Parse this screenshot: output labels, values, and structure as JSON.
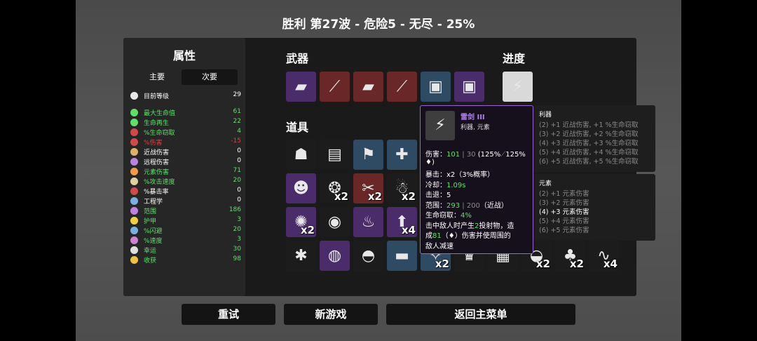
{
  "header": {
    "title": "胜利    第27波 - 危险5 - 无尽 - 25%"
  },
  "stats": {
    "title": "属性",
    "tabs": {
      "main": "主要",
      "secondary": "次要"
    },
    "level": {
      "label": "目前等级",
      "value": "29"
    },
    "rows": [
      {
        "label": "最大生命值",
        "value": "61",
        "color": "#5fe06a",
        "icon_color": "#5fe06a",
        "icon": "heart-icon"
      },
      {
        "label": "生命再生",
        "value": "22",
        "color": "#5fe06a",
        "icon_color": "#5fe06a",
        "icon": "regen-icon"
      },
      {
        "label": "%生命窃取",
        "value": "4",
        "color": "#5fe06a",
        "icon_color": "#d04a4a",
        "icon": "lifesteal-icon"
      },
      {
        "label": "%伤害",
        "value": "-15",
        "color": "#e04040",
        "icon_color": "#d04a4a",
        "icon": "damage-icon"
      },
      {
        "label": "近战伤害",
        "value": "0",
        "color": "#ffffff",
        "icon_color": "#d9b36a",
        "icon": "melee-icon"
      },
      {
        "label": "远程伤害",
        "value": "0",
        "color": "#ffffff",
        "icon_color": "#b486e0",
        "icon": "ranged-icon"
      },
      {
        "label": "元素伤害",
        "value": "71",
        "color": "#5fe06a",
        "icon_color": "#f09a4a",
        "icon": "elemental-icon"
      },
      {
        "label": "%攻击速度",
        "value": "20",
        "color": "#5fe06a",
        "icon_color": "#e0d0a0",
        "icon": "attack-speed-icon"
      },
      {
        "label": "%暴击率",
        "value": "0",
        "color": "#ffffff",
        "icon_color": "#d04a4a",
        "icon": "crit-icon"
      },
      {
        "label": "工程学",
        "value": "0",
        "color": "#ffffff",
        "icon_color": "#7ab0e0",
        "icon": "engineering-icon"
      },
      {
        "label": "范围",
        "value": "186",
        "color": "#5fe06a",
        "icon_color": "#c080e0",
        "icon": "range-icon"
      },
      {
        "label": "护甲",
        "value": "3",
        "color": "#5fe06a",
        "icon_color": "#f0d040",
        "icon": "armor-icon"
      },
      {
        "label": "%闪避",
        "value": "20",
        "color": "#5fe06a",
        "icon_color": "#7ab0e0",
        "icon": "dodge-icon"
      },
      {
        "label": "%速度",
        "value": "3",
        "color": "#5fe06a",
        "icon_color": "#d080d0",
        "icon": "speed-icon"
      },
      {
        "label": "幸运",
        "value": "30",
        "color": "#5fe06a",
        "icon_color": "#e0e0e0",
        "icon": "luck-icon"
      },
      {
        "label": "收获",
        "value": "98",
        "color": "#5fe06a",
        "icon_color": "#f0c040",
        "icon": "harvest-icon"
      }
    ]
  },
  "weapons": {
    "title": "武器",
    "items": [
      {
        "name": "rocket-launcher-icon",
        "tier": "t3",
        "glyph": "▰",
        "count": ""
      },
      {
        "name": "magic-wand-icon",
        "tier": "t4",
        "glyph": "⟋",
        "count": ""
      },
      {
        "name": "rocket-launcher-icon",
        "tier": "t4",
        "glyph": "▰",
        "count": ""
      },
      {
        "name": "magic-wand-icon",
        "tier": "t4",
        "glyph": "⟋",
        "count": ""
      },
      {
        "name": "flamethrower-icon",
        "tier": "t2",
        "glyph": "▣",
        "count": ""
      },
      {
        "name": "flamethrower-icon",
        "tier": "t3",
        "glyph": "▣",
        "count": ""
      }
    ]
  },
  "progress": {
    "title": "进度",
    "items": [
      {
        "name": "thunder-sword-icon",
        "tier": "t5",
        "glyph": "⚡",
        "count": ""
      }
    ]
  },
  "items": {
    "title": "道具",
    "rows": [
      [
        {
          "name": "mushroom-icon",
          "tier": "t1",
          "glyph": "☗",
          "count": ""
        },
        {
          "name": "banknote-icon",
          "tier": "t1",
          "glyph": "▤",
          "count": ""
        },
        {
          "name": "flag-icon",
          "tier": "t2",
          "glyph": "⚑",
          "count": ""
        },
        {
          "name": "medkit-robot-icon",
          "tier": "t2",
          "glyph": "✚",
          "count": ""
        }
      ],
      [
        {
          "name": "zombie-head-icon",
          "tier": "t3",
          "glyph": "☻",
          "count": ""
        },
        {
          "name": "tardigrade-icon",
          "tier": "t1",
          "glyph": "❂",
          "count": "x2"
        },
        {
          "name": "scissors-icon",
          "tier": "t4",
          "glyph": "✂",
          "count": "x2"
        },
        {
          "name": "ghost-icon",
          "tier": "t1",
          "glyph": "☃",
          "count": "x2"
        }
      ],
      [
        {
          "name": "peacock-icon",
          "tier": "t3",
          "glyph": "✺",
          "count": "x2"
        },
        {
          "name": "helmet-robot-icon",
          "tier": "t1",
          "glyph": "◉",
          "count": ""
        },
        {
          "name": "candle-icon",
          "tier": "t3",
          "glyph": "♨",
          "count": ""
        },
        {
          "name": "rocket-icon",
          "tier": "t3",
          "glyph": "⬆",
          "count": "x4"
        }
      ],
      [
        {
          "name": "spider-icon",
          "tier": "t1",
          "glyph": "✱",
          "count": ""
        },
        {
          "name": "snake-ring-icon",
          "tier": "t3",
          "glyph": "◍",
          "count": ""
        },
        {
          "name": "landmine-icon",
          "tier": "t1",
          "glyph": "◓",
          "count": ""
        },
        {
          "name": "scarf-icon",
          "tier": "t2",
          "glyph": "▬",
          "count": ""
        },
        {
          "name": "drone-icon",
          "tier": "t2",
          "glyph": "✧",
          "count": "x2"
        },
        {
          "name": "crown-icon",
          "tier": "t1",
          "glyph": "♛",
          "count": ""
        },
        {
          "name": "jacket-icon",
          "tier": "t1",
          "glyph": "▦",
          "count": ""
        },
        {
          "name": "bowl-icon",
          "tier": "t1",
          "glyph": "◒",
          "count": "x2"
        },
        {
          "name": "tree-icon",
          "tier": "t1",
          "glyph": "♣",
          "count": "x2"
        },
        {
          "name": "worm-icon",
          "tier": "t1",
          "glyph": "∿",
          "count": "x4"
        }
      ]
    ]
  },
  "tooltip": {
    "name": "雷剑 III",
    "tags": "利器, 元素",
    "lines": [
      {
        "parts": [
          {
            "t": "伤害：",
            "c": ""
          },
          {
            "t": "101",
            "c": "green"
          },
          {
            "t": " | 30",
            "c": "gray"
          },
          {
            "t": " (125%",
            "c": ""
          },
          {
            "t": "⟋",
            "c": "gray"
          },
          {
            "t": "125%",
            "c": ""
          }
        ]
      },
      {
        "parts": [
          {
            "t": "♦)",
            "c": ""
          }
        ]
      },
      {
        "parts": [
          {
            "t": "暴击：x2（3%概率）",
            "c": ""
          }
        ]
      },
      {
        "parts": [
          {
            "t": "冷却：",
            "c": ""
          },
          {
            "t": "1.09s",
            "c": "green"
          }
        ]
      },
      {
        "parts": [
          {
            "t": "击退：5",
            "c": ""
          }
        ]
      },
      {
        "parts": [
          {
            "t": "范围：",
            "c": ""
          },
          {
            "t": "293",
            "c": "green"
          },
          {
            "t": " | 200",
            "c": "gray"
          },
          {
            "t": "（近战）",
            "c": ""
          }
        ]
      },
      {
        "parts": [
          {
            "t": "生命窃取：",
            "c": ""
          },
          {
            "t": "4%",
            "c": "green"
          }
        ]
      },
      {
        "parts": [
          {
            "t": "击中敌人时产生",
            "c": ""
          },
          {
            "t": "2",
            "c": "green"
          },
          {
            "t": "投射物，造",
            "c": ""
          }
        ]
      },
      {
        "parts": [
          {
            "t": "成",
            "c": ""
          },
          {
            "t": "81",
            "c": "green"
          },
          {
            "t": "（♦）伤害并使周围的",
            "c": ""
          }
        ]
      },
      {
        "parts": [
          {
            "t": "敌人减速",
            "c": ""
          }
        ]
      }
    ]
  },
  "set_bonus_sharp": {
    "title": "利器",
    "lines": [
      {
        "text": "(2) +1 近战伤害, +1 %生命窃取",
        "on": false
      },
      {
        "text": "(3) +2 近战伤害, +2 %生命窃取",
        "on": false
      },
      {
        "text": "(4) +3 近战伤害, +3 %生命窃取",
        "on": false
      },
      {
        "text": "(5) +4 近战伤害, +4 %生命窃取",
        "on": false
      },
      {
        "text": "(6) +5 近战伤害, +5 %生命窃取",
        "on": false
      }
    ]
  },
  "set_bonus_elemental": {
    "title": "元素",
    "lines": [
      {
        "text": "(2) +1 元素伤害",
        "on": false
      },
      {
        "text": "(3) +2 元素伤害",
        "on": false
      },
      {
        "text": "(4) +3 元素伤害",
        "on": true
      },
      {
        "text": "(5) +4 元素伤害",
        "on": false
      },
      {
        "text": "(6) +5 元素伤害",
        "on": false
      }
    ]
  },
  "buttons": {
    "retry": "重试",
    "new_game": "新游戏",
    "main_menu": "返回主菜单"
  }
}
